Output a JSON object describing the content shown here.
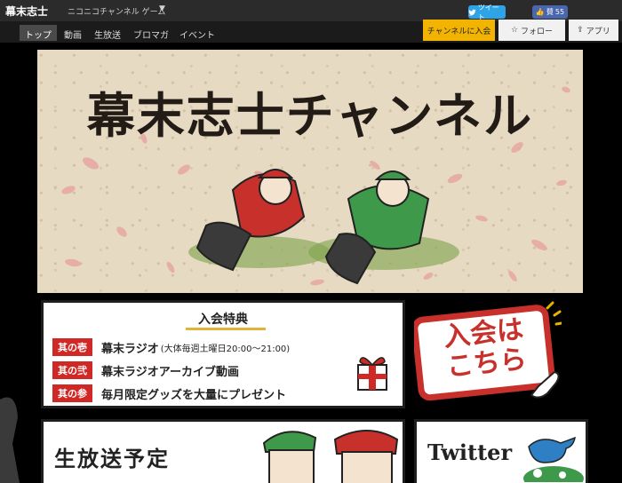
{
  "header": {
    "brand": "幕末志士",
    "subtitle": "ニコニコチャンネル ゲーム",
    "menu_caret": "▼",
    "tweet_label": "ツイート",
    "like_label": "賛",
    "like_count": "55"
  },
  "nav": {
    "tabs": [
      {
        "label": "トップ",
        "active": true
      },
      {
        "label": "動画",
        "active": false
      },
      {
        "label": "生放送",
        "active": false
      },
      {
        "label": "ブロマガ",
        "active": false
      },
      {
        "label": "イベント",
        "active": false
      }
    ],
    "join_button": "チャンネルに入会",
    "follow_button": "フォロー",
    "app_button": "アプリ"
  },
  "banner": {
    "title": "幕末志士チャンネル"
  },
  "perks": {
    "title": "入会特典",
    "items": [
      {
        "tag": "其の壱",
        "text": "幕末ラジオ",
        "note": "(大体毎週土曜日20:00～21:00)"
      },
      {
        "tag": "其の弐",
        "text": "幕末ラジオアーカイブ動画",
        "note": ""
      },
      {
        "tag": "其の参",
        "text": "毎月限定グッズを大量にプレゼント",
        "note": ""
      }
    ]
  },
  "join_badge": {
    "line1": "入会は",
    "line2": "こちら"
  },
  "live_panel": {
    "title": "生放送予定"
  },
  "twitter_panel": {
    "title": "Twitter"
  },
  "colors": {
    "topbar": "#2b2b2b",
    "navbar": "#1b1b1b",
    "join_yellow": "#f2b400",
    "banner_paper": "#e7dac3",
    "perk_red": "#d02825",
    "twitter_blue": "#2e7fc4",
    "tweet_blue": "#2ea4e6",
    "like_blue": "#4a67ad"
  }
}
